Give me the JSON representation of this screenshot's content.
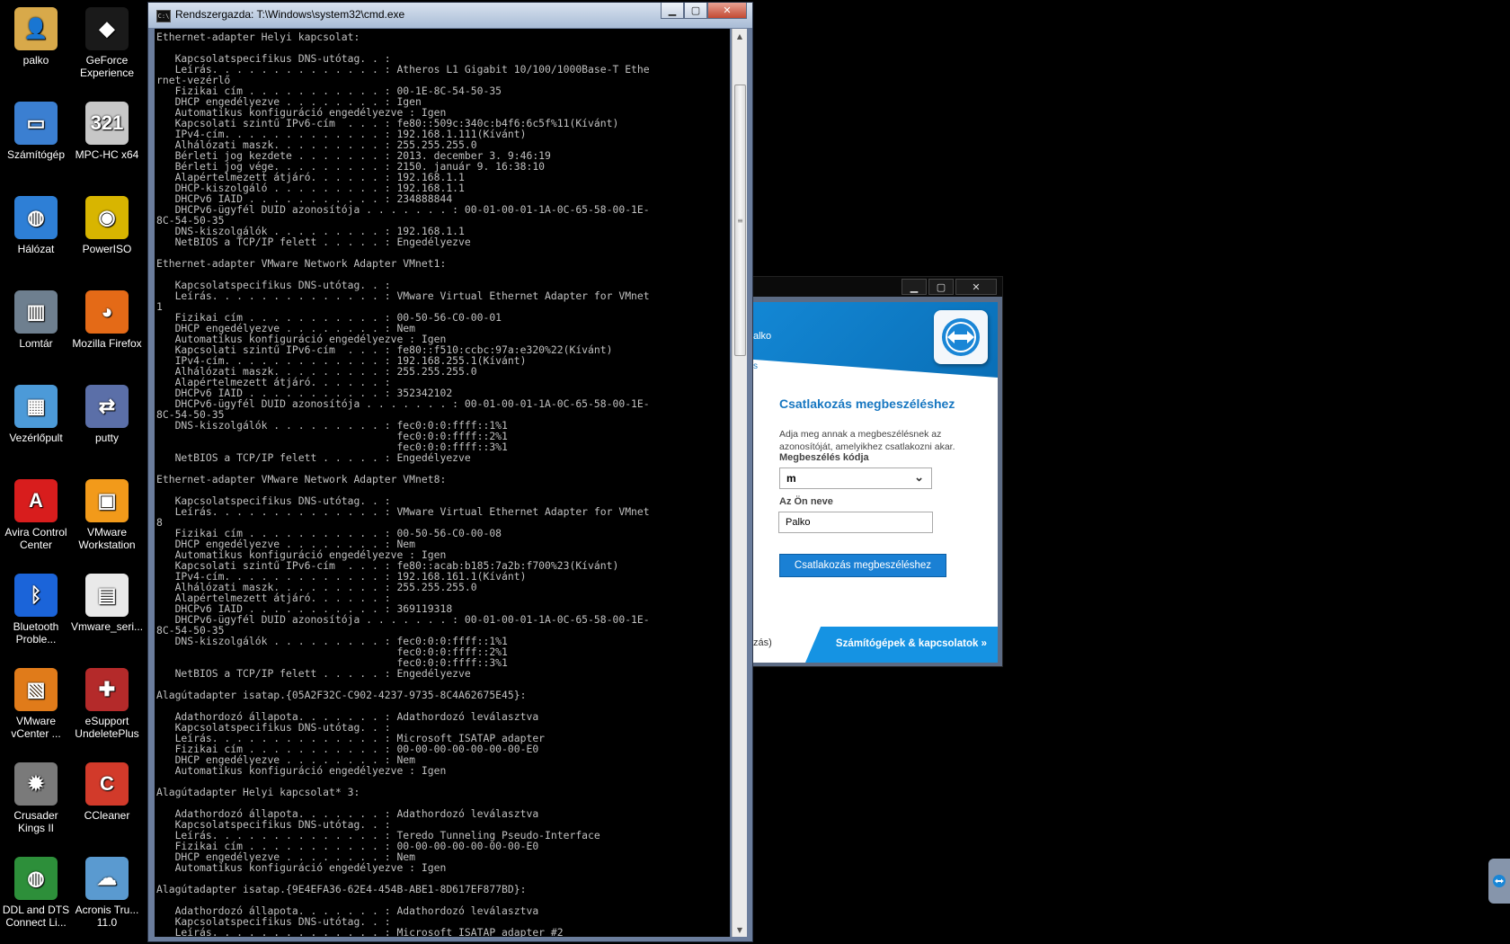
{
  "desktop": {
    "icons": [
      {
        "label": "palko",
        "glyph": "👤",
        "bg": "#d8a94a"
      },
      {
        "label": "GeForce Experience",
        "glyph": "◆",
        "bg": "#1a1a1a"
      },
      {
        "label": "Számítógép",
        "glyph": "▭",
        "bg": "#3b7fd1"
      },
      {
        "label": "MPC-HC x64",
        "glyph": "321",
        "bg": "#c7c7c7"
      },
      {
        "label": "Hálózat",
        "glyph": "◍",
        "bg": "#2e7fd6"
      },
      {
        "label": "PowerISO",
        "glyph": "◉",
        "bg": "#d8b500"
      },
      {
        "label": "Lomtár",
        "glyph": "▥",
        "bg": "#6e7f8f"
      },
      {
        "label": "Mozilla Firefox",
        "glyph": "◕",
        "bg": "#e46a17"
      },
      {
        "label": "Vezérlőpult",
        "glyph": "▦",
        "bg": "#4c9ad8"
      },
      {
        "label": "putty",
        "glyph": "⇄",
        "bg": "#5b6fa8"
      },
      {
        "label": "Avira Control Center",
        "glyph": "A",
        "bg": "#d81d1d"
      },
      {
        "label": "VMware Workstation",
        "glyph": "▣",
        "bg": "#f29a1a"
      },
      {
        "label": "Bluetooth Proble...",
        "glyph": "ᛒ",
        "bg": "#1b64d9"
      },
      {
        "label": "Vmware_seri...",
        "glyph": "▤",
        "bg": "#e9e9e9"
      },
      {
        "label": "VMware vCenter ...",
        "glyph": "▧",
        "bg": "#e07b1a"
      },
      {
        "label": "eSupport UndeletePlus",
        "glyph": "✚",
        "bg": "#b42a2a"
      },
      {
        "label": "Crusader Kings II",
        "glyph": "✹",
        "bg": "#7a7a7a"
      },
      {
        "label": "CCleaner",
        "glyph": "C",
        "bg": "#d23a2a"
      },
      {
        "label": "DDL and DTS Connect Li...",
        "glyph": "◍",
        "bg": "#2d8f3a"
      },
      {
        "label": "Acronis Tru... 11.0",
        "glyph": "☁",
        "bg": "#5a9ad0"
      }
    ]
  },
  "cmd": {
    "title": "Rendszergazda: T:\\Windows\\system32\\cmd.exe",
    "icon_label": "C:\\",
    "minimize": "▁",
    "maximize": "▢",
    "close": "✕",
    "scroll_up": "▲",
    "scroll_down": "▼",
    "scroll_grip": "≡",
    "output": "Ethernet-adapter Helyi kapcsolat:\n\n   Kapcsolatspecifikus DNS-utótag. . :\n   Leírás. . . . . . . . . . . . . . : Atheros L1 Gigabit 10/100/1000Base-T Ethe\nrnet-vezérlő\n   Fizikai cím . . . . . . . . . . . : 00-1E-8C-54-50-35\n   DHCP engedélyezve . . . . . . . . : Igen\n   Automatikus konfiguráció engedélyezve : Igen\n   Kapcsolati szintű IPv6-cím  . . . : fe80::509c:340c:b4f6:6c5f%11(Kívánt)\n   IPv4-cím. . . . . . . . . . . . . : 192.168.1.111(Kívánt)\n   Alhálózati maszk. . . . . . . . . : 255.255.255.0\n   Bérleti jog kezdete . . . . . . . : 2013. december 3. 9:46:19\n   Bérleti jog vége. . . . . . . . . : 2150. január 9. 16:38:10\n   Alapértelmezett átjáró. . . . . . : 192.168.1.1\n   DHCP-kiszolgáló . . . . . . . . . : 192.168.1.1\n   DHCPv6 IAID . . . . . . . . . . . : 234888844\n   DHCPv6-ügyfél DUID azonosítója . . . . . . . : 00-01-00-01-1A-0C-65-58-00-1E-\n8C-54-50-35\n   DNS-kiszolgálók . . . . . . . . . : 192.168.1.1\n   NetBIOS a TCP/IP felett . . . . . : Engedélyezve\n\nEthernet-adapter VMware Network Adapter VMnet1:\n\n   Kapcsolatspecifikus DNS-utótag. . :\n   Leírás. . . . . . . . . . . . . . : VMware Virtual Ethernet Adapter for VMnet\n1\n   Fizikai cím . . . . . . . . . . . : 00-50-56-C0-00-01\n   DHCP engedélyezve . . . . . . . . : Nem\n   Automatikus konfiguráció engedélyezve : Igen\n   Kapcsolati szintű IPv6-cím  . . . : fe80::f510:ccbc:97a:e320%22(Kívánt)\n   IPv4-cím. . . . . . . . . . . . . : 192.168.255.1(Kívánt)\n   Alhálózati maszk. . . . . . . . . : 255.255.255.0\n   Alapértelmezett átjáró. . . . . . :\n   DHCPv6 IAID . . . . . . . . . . . : 352342102\n   DHCPv6-ügyfél DUID azonosítója . . . . . . . : 00-01-00-01-1A-0C-65-58-00-1E-\n8C-54-50-35\n   DNS-kiszolgálók . . . . . . . . . : fec0:0:0:ffff::1%1\n                                       fec0:0:0:ffff::2%1\n                                       fec0:0:0:ffff::3%1\n   NetBIOS a TCP/IP felett . . . . . : Engedélyezve\n\nEthernet-adapter VMware Network Adapter VMnet8:\n\n   Kapcsolatspecifikus DNS-utótag. . :\n   Leírás. . . . . . . . . . . . . . : VMware Virtual Ethernet Adapter for VMnet\n8\n   Fizikai cím . . . . . . . . . . . : 00-50-56-C0-00-08\n   DHCP engedélyezve . . . . . . . . : Nem\n   Automatikus konfiguráció engedélyezve : Igen\n   Kapcsolati szintű IPv6-cím  . . . : fe80::acab:b185:7a2b:f700%23(Kívánt)\n   IPv4-cím. . . . . . . . . . . . . : 192.168.161.1(Kívánt)\n   Alhálózati maszk. . . . . . . . . : 255.255.255.0\n   Alapértelmezett átjáró. . . . . . :\n   DHCPv6 IAID . . . . . . . . . . . : 369119318\n   DHCPv6-ügyfél DUID azonosítója . . . . . . . : 00-01-00-01-1A-0C-65-58-00-1E-\n8C-54-50-35\n   DNS-kiszolgálók . . . . . . . . . : fec0:0:0:ffff::1%1\n                                       fec0:0:0:ffff::2%1\n                                       fec0:0:0:ffff::3%1\n   NetBIOS a TCP/IP felett . . . . . : Engedélyezve\n\nAlagútadapter isatap.{05A2F32C-C902-4237-9735-8C4A62675E45}:\n\n   Adathordozó állapota. . . . . . . : Adathordozó leválasztva\n   Kapcsolatspecifikus DNS-utótag. . :\n   Leírás. . . . . . . . . . . . . . : Microsoft ISATAP adapter\n   Fizikai cím . . . . . . . . . . . : 00-00-00-00-00-00-00-E0\n   DHCP engedélyezve . . . . . . . . : Nem\n   Automatikus konfiguráció engedélyezve : Igen\n\nAlagútadapter Helyi kapcsolat* 3:\n\n   Adathordozó állapota. . . . . . . : Adathordozó leválasztva\n   Kapcsolatspecifikus DNS-utótag. . :\n   Leírás. . . . . . . . . . . . . . : Teredo Tunneling Pseudo-Interface\n   Fizikai cím . . . . . . . . . . . : 00-00-00-00-00-00-00-E0\n   DHCP engedélyezve . . . . . . . . : Nem\n   Automatikus konfiguráció engedélyezve : Igen\n\nAlagútadapter isatap.{9E4EFA36-62E4-454B-ABE1-8D617EF877BD}:\n\n   Adathordozó állapota. . . . . . . : Adathordozó leválasztva\n   Kapcsolatspecifikus DNS-utótag. . :\n   Leírás. . . . . . . . . . . . . . : Microsoft ISATAP adapter #2"
  },
  "teamviewer": {
    "minimize": "▁",
    "maximize": "▢",
    "close": "✕",
    "header_user": "alko",
    "header_tab": "s",
    "title": "Csatlakozás megbeszéléshez",
    "description": "Adja meg annak a megbeszélésnek az azonosítóját, amelyikhez csatlakozni akar.",
    "meeting_code_label": "Megbeszélés kódja",
    "meeting_code_value": "m",
    "chevron": "⌄",
    "name_label": "Az Ön neve",
    "name_value": "Palko",
    "join_button": "Csatlakozás megbeszéléshez",
    "footer_left": "zás)",
    "footer_right": "Számítógépek & kapcsolatok  »"
  },
  "colors": {
    "tv_blue": "#1387d4",
    "tv_title": "#1777c1",
    "cmd_text": "#c0c0c0"
  }
}
